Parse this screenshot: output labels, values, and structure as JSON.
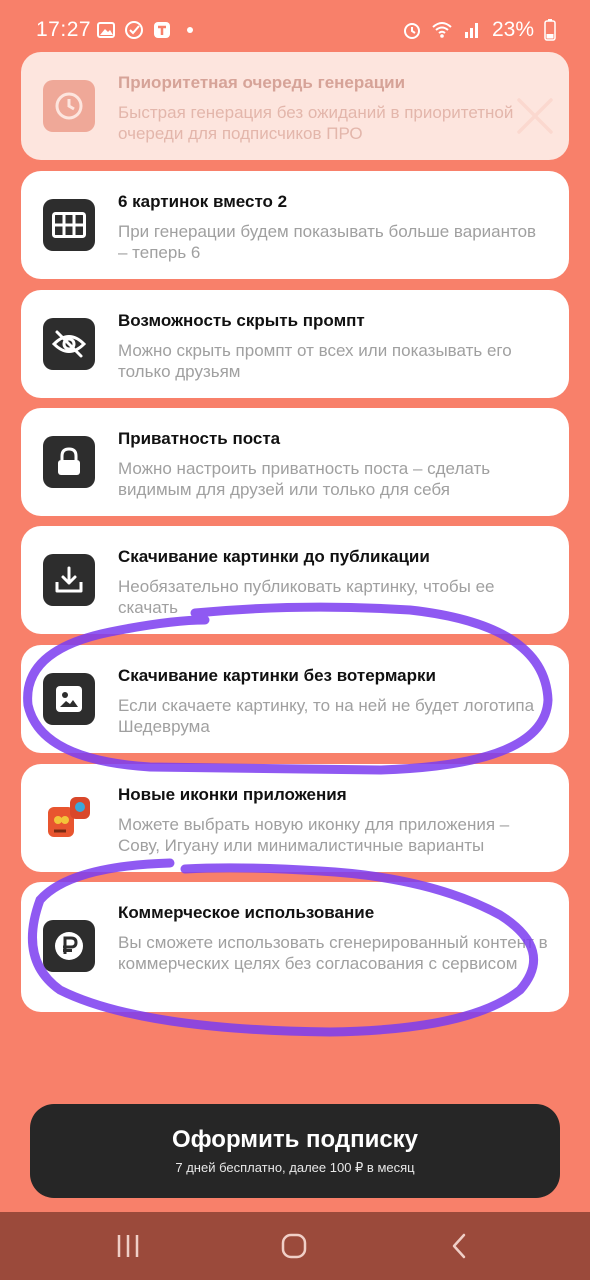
{
  "status_bar": {
    "time": "17:27",
    "battery": "23%"
  },
  "features": [
    {
      "title": "Приоритетная очередь генерации",
      "description": "Быстрая генерация без ожиданий в приоритетной очереди для подписчиков ПРО",
      "icon": "clock-icon"
    },
    {
      "title": "6 картинок вместо 2",
      "description": "При генерации будем показывать больше вариантов – теперь 6",
      "icon": "grid-icon"
    },
    {
      "title": "Возможность скрыть промпт",
      "description": "Можно скрыть промпт от всех или показывать его только друзьям",
      "icon": "eye-off-icon"
    },
    {
      "title": "Приватность поста",
      "description": "Можно настроить приватность поста – сделать видимым для друзей или только для себя",
      "icon": "lock-icon"
    },
    {
      "title": "Скачивание картинки до публикации",
      "description": "Необязательно публиковать картинку, чтобы ее скачать",
      "icon": "download-icon"
    },
    {
      "title": "Скачивание картинки без вотермарки",
      "description": "Если скачаете картинку, то на ней не будет логотипа Шедеврума",
      "icon": "image-icon"
    },
    {
      "title": "Новые иконки приложения",
      "description": "Можете выбрать новую иконку для приложения – Сову, Игуану или минималистичные варианты",
      "icon": "app-icons-icon"
    },
    {
      "title": "Коммерческое использование",
      "description": "Вы сможете использовать сгенерированный контент в коммерческих целях без согласования с сервисом",
      "icon": "ruble-icon"
    }
  ],
  "cta": {
    "label": "Оформить подписку",
    "sublabel": "7 дней бесплатно, далее 100 ₽ в месяц"
  },
  "colors": {
    "background": "#f8806a",
    "button": "#262626",
    "nav_bar": "#9b4a3b",
    "annotation": "#7b3cf0"
  }
}
